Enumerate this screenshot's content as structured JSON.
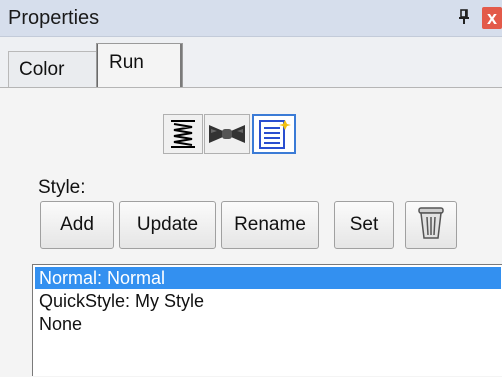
{
  "panel": {
    "title": "Properties",
    "pin_icon": "pin-icon",
    "close_icon": "close-icon",
    "close_glyph": "x",
    "accent": "#3390f0"
  },
  "tabs": [
    {
      "label": "Color",
      "selected": false
    },
    {
      "label": "Run",
      "selected": true
    }
  ],
  "toolbar": {
    "icons": [
      {
        "name": "spring-icon",
        "selected": false
      },
      {
        "name": "bowtie-icon",
        "selected": false
      },
      {
        "name": "document-icon",
        "selected": true
      }
    ]
  },
  "style_section": {
    "label": "Style:",
    "buttons": {
      "add": "Add",
      "update": "Update",
      "rename": "Rename",
      "set": "Set",
      "delete_icon": "trash-icon"
    }
  },
  "style_list": {
    "items": [
      {
        "text": "Normal: Normal",
        "selected": true
      },
      {
        "text": "QuickStyle: My Style",
        "selected": false
      },
      {
        "text": "None",
        "selected": false
      }
    ]
  }
}
